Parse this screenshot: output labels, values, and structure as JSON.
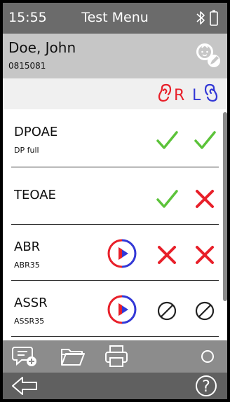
{
  "status_bar": {
    "time": "15:55",
    "title": "Test Menu"
  },
  "patient": {
    "name": "Doe, John",
    "id": "0815081"
  },
  "ear_header": {
    "right_label": "R",
    "left_label": "L"
  },
  "tests": [
    {
      "title": "DPOAE",
      "subtitle": "DP full",
      "has_start": false,
      "right_result": "pass",
      "left_result": "pass"
    },
    {
      "title": "TEOAE",
      "subtitle": "",
      "has_start": false,
      "right_result": "pass",
      "left_result": "refer"
    },
    {
      "title": "ABR",
      "subtitle": "ABR35",
      "has_start": true,
      "right_result": "refer",
      "left_result": "refer"
    },
    {
      "title": "ASSR",
      "subtitle": "ASSR35",
      "has_start": true,
      "right_result": "not-tested",
      "left_result": "not-tested"
    }
  ],
  "colors": {
    "pass": "#5cc33a",
    "refer": "#e8202a",
    "right_ear": "#e8202a",
    "left_ear": "#3338d6"
  },
  "icons": {
    "toolbar": [
      "comment-add-icon",
      "folder-icon",
      "printer-icon",
      "circle-icon"
    ],
    "nav": [
      "back-arrow-icon",
      "help-icon"
    ]
  }
}
